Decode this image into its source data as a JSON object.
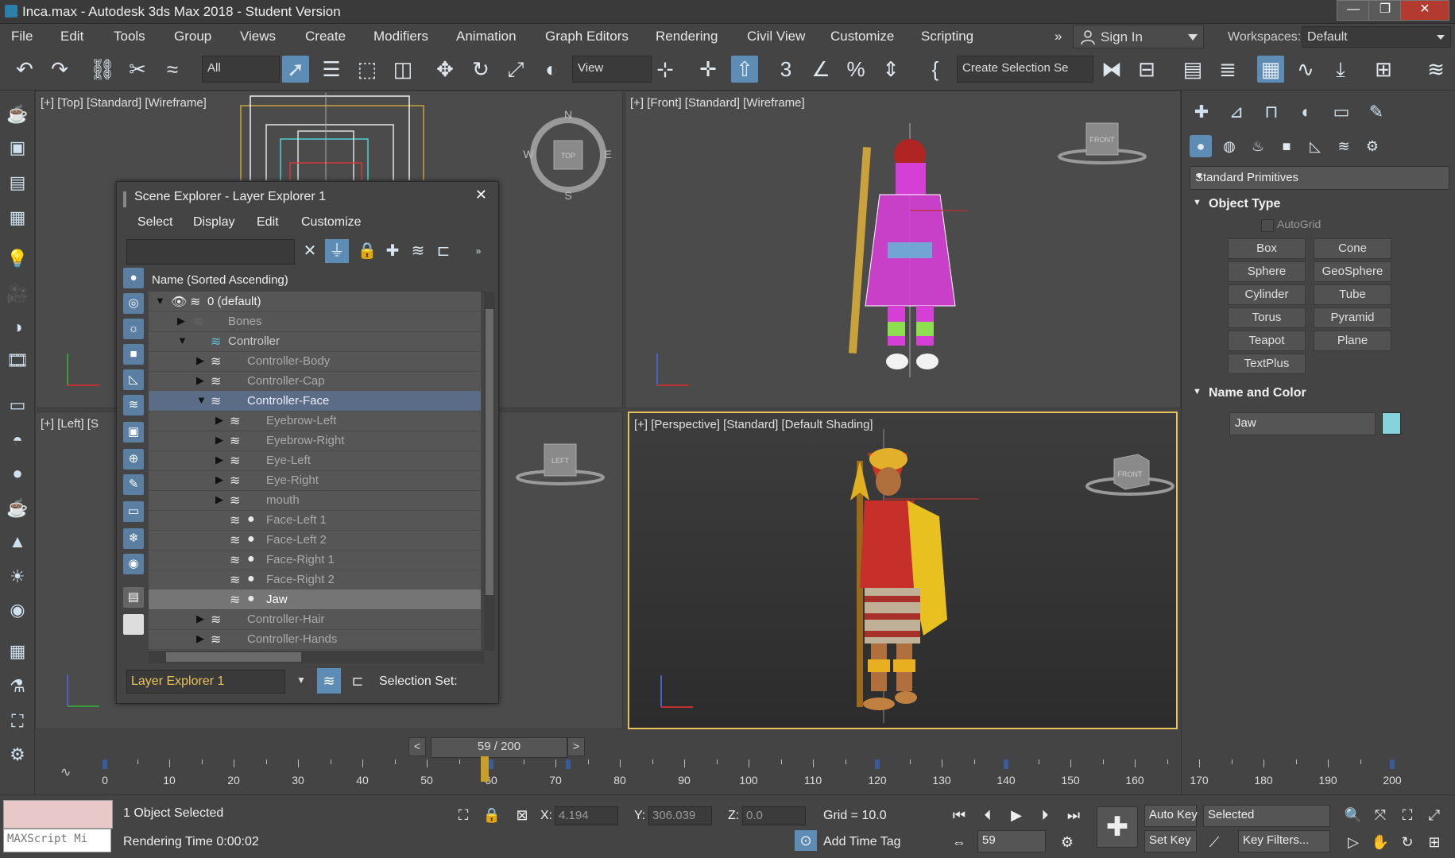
{
  "window": {
    "title": "Inca.max - Autodesk 3ds Max 2018 - Student Version",
    "minimize_label": "—",
    "maximize_label": "❐",
    "close_label": "✕"
  },
  "menubar": {
    "items": [
      "File",
      "Edit",
      "Tools",
      "Group",
      "Views",
      "Create",
      "Modifiers",
      "Animation",
      "Graph Editors",
      "Rendering",
      "Civil View",
      "Customize",
      "Scripting"
    ],
    "overflow": "»",
    "sign_in": "Sign In",
    "workspaces_label": "Workspaces:",
    "workspace_value": "Default"
  },
  "toolbar": {
    "filter_value": "All",
    "ref_coord_value": "View",
    "selection_set_value": "Create Selection Se"
  },
  "viewports": {
    "top": "[+] [Top] [Standard] [Wireframe]",
    "front": "[+] [Front] [Standard] [Wireframe]",
    "left": "[+] [Left] [S",
    "perspective": "[+] [Perspective] [Standard] [Default Shading]",
    "viewcube_top": "TOP",
    "viewcube_front": "FRONT",
    "viewcube_left": "LEFT",
    "compass": [
      "N",
      "E",
      "S",
      "W"
    ]
  },
  "scene_explorer": {
    "title": "Scene Explorer - Layer Explorer 1",
    "menus": [
      "Select",
      "Display",
      "Edit",
      "Customize"
    ],
    "column_header": "Name (Sorted Ascending)",
    "tree": [
      {
        "label": "0 (default)",
        "level": 0,
        "expanded": true
      },
      {
        "label": "Bones",
        "level": 1,
        "expanded": false
      },
      {
        "label": "Controller",
        "level": 1,
        "expanded": true
      },
      {
        "label": "Controller-Body",
        "level": 2,
        "expanded": false
      },
      {
        "label": "Controller-Cap",
        "level": 2,
        "expanded": false
      },
      {
        "label": "Controller-Face",
        "level": 2,
        "expanded": true,
        "selected": true
      },
      {
        "label": "Eyebrow-Left",
        "level": 3,
        "expanded": false
      },
      {
        "label": "Eyebrow-Right",
        "level": 3,
        "expanded": false
      },
      {
        "label": "Eye-Left",
        "level": 3,
        "expanded": false
      },
      {
        "label": "Eye-Right",
        "level": 3,
        "expanded": false
      },
      {
        "label": "mouth",
        "level": 3,
        "expanded": false
      },
      {
        "label": "Face-Left 1",
        "level": 3,
        "object": true
      },
      {
        "label": "Face-Left 2",
        "level": 3,
        "object": true
      },
      {
        "label": "Face-Right 1",
        "level": 3,
        "object": true
      },
      {
        "label": "Face-Right 2",
        "level": 3,
        "object": true
      },
      {
        "label": "Jaw",
        "level": 3,
        "object": true,
        "highlighted": true
      },
      {
        "label": "Controller-Hair",
        "level": 2,
        "expanded": false
      },
      {
        "label": "Controller-Hands",
        "level": 2,
        "expanded": false
      }
    ],
    "layer_explorer_value": "Layer Explorer 1",
    "selection_set_label": "Selection Set:"
  },
  "command_panel": {
    "category_value": "Standard Primitives",
    "object_type_title": "Object Type",
    "autogrid_label": "AutoGrid",
    "primitives": [
      "Box",
      "Cone",
      "Sphere",
      "GeoSphere",
      "Cylinder",
      "Tube",
      "Torus",
      "Pyramid",
      "Teapot",
      "Plane",
      "TextPlus"
    ],
    "name_color_title": "Name and Color",
    "object_name": "Jaw",
    "object_color": "#86d3db"
  },
  "timeline": {
    "frame_display": "59 / 200",
    "prev": "<",
    "next": ">",
    "current_frame": 59,
    "total_frames": 200,
    "ticks": [
      0,
      10,
      20,
      30,
      40,
      50,
      60,
      70,
      80,
      90,
      100,
      110,
      120,
      130,
      140,
      150,
      160,
      170,
      180,
      190,
      200
    ],
    "keyframes": [
      0,
      60,
      72,
      120,
      140,
      200
    ]
  },
  "status": {
    "maxscript_label": "MAXScript Mi",
    "objects_selected": "1 Object Selected",
    "rendering_time": "Rendering Time  0:00:02",
    "x_label": "X:",
    "x_value": "4.194",
    "y_label": "Y:",
    "y_value": "306.039",
    "z_label": "Z:",
    "z_value": "0.0",
    "grid": "Grid = 10.0",
    "add_time_tag": "Add Time Tag",
    "auto_key": "Auto Key",
    "set_key": "Set Key",
    "selected_value": "Selected",
    "key_filters": "Key Filters...",
    "frame_field": "59"
  },
  "colors": {
    "accent": "#5d8db5",
    "active_viewport_border": "#e8c25a",
    "selection_row": "#5a6c86"
  }
}
